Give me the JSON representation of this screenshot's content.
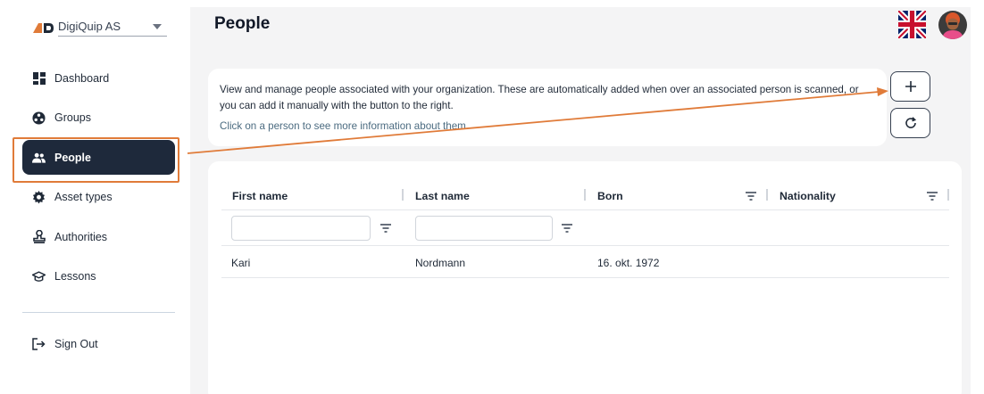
{
  "organization": {
    "name": "DigiQuip AS"
  },
  "sidebar": {
    "items": [
      {
        "label": "Dashboard",
        "icon": "dashboard-icon"
      },
      {
        "label": "Groups",
        "icon": "groups-icon"
      },
      {
        "label": "People",
        "icon": "people-icon",
        "active": true
      },
      {
        "label": "Asset types",
        "icon": "gear-icon"
      },
      {
        "label": "Authorities",
        "icon": "authority-icon"
      },
      {
        "label": "Lessons",
        "icon": "graduation-cap-icon"
      }
    ],
    "sign_out": "Sign Out"
  },
  "header": {
    "title": "People",
    "language_icon": "uk-flag-icon",
    "avatar_icon": "avatar-icon"
  },
  "info": {
    "description": "View and manage people associated with your organization. These are automatically added when over an associated person is scanned, or you can add it manually with the button to the right.",
    "hint": "Click on a person to see more information about them."
  },
  "actions": {
    "add_icon": "plus-icon",
    "refresh_icon": "refresh-icon"
  },
  "table": {
    "columns": [
      "First name",
      "Last name",
      "Born",
      "Nationality"
    ],
    "rows": [
      {
        "first_name": "Kari",
        "last_name": "Nordmann",
        "born": "16. okt. 1972",
        "nationality": ""
      }
    ]
  },
  "colors": {
    "accent": "#e07b39",
    "sidebar_active": "#1e293b",
    "link": "#4b6b80"
  }
}
